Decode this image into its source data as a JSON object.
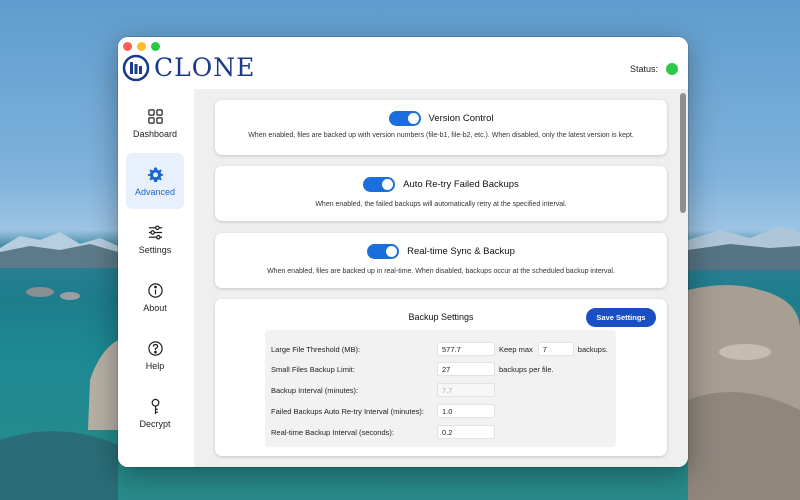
{
  "window": {
    "logo_text": "CLONE",
    "status_label": "Status:",
    "status_color": "#2ec84a"
  },
  "sidebar": {
    "items": [
      {
        "label": "Dashboard",
        "icon": "grid-icon",
        "active": false
      },
      {
        "label": "Advanced",
        "icon": "gear-icon",
        "active": true
      },
      {
        "label": "Settings",
        "icon": "sliders-icon",
        "active": false
      },
      {
        "label": "About",
        "icon": "info-icon",
        "active": false
      },
      {
        "label": "Help",
        "icon": "question-icon",
        "active": false
      },
      {
        "label": "Decrypt",
        "icon": "key-icon",
        "active": false
      }
    ]
  },
  "cards": [
    {
      "title": "Version Control",
      "enabled": true,
      "description": "When enabled, files are backed up with version numbers (file-b1, file-b2, etc.). When disabled, only the latest version is kept."
    },
    {
      "title": "Auto Re-try Failed Backups",
      "enabled": true,
      "description": "When enabled, the failed backups will automatically retry at the specified interval."
    },
    {
      "title": "Real-time Sync & Backup",
      "enabled": true,
      "description": "When enabled, files are backed up in real-time. When disabled, backups occur at the scheduled backup interval."
    }
  ],
  "backup_settings": {
    "title": "Backup Settings",
    "save_label": "Save Settings",
    "rows": [
      {
        "label": "Large File Threshold (MB):",
        "value": "577.7",
        "keep_max_label": "Keep max",
        "keep_max_value": "7",
        "suffix": "backups."
      },
      {
        "label": "Small Files Backup Limit:",
        "value": "27",
        "suffix": "backups per file."
      },
      {
        "label": "Backup Interval (minutes):",
        "value": "7.7",
        "disabled": true
      },
      {
        "label": "Failed Backups Auto Re-try Interval (minutes):",
        "value": "1.0"
      },
      {
        "label": "Real-time Backup Interval (seconds):",
        "value": "0.2"
      }
    ]
  },
  "colors": {
    "accent": "#1b6fdc",
    "active_nav_bg": "#e8f1fb",
    "save_button": "#1a4fc4"
  }
}
